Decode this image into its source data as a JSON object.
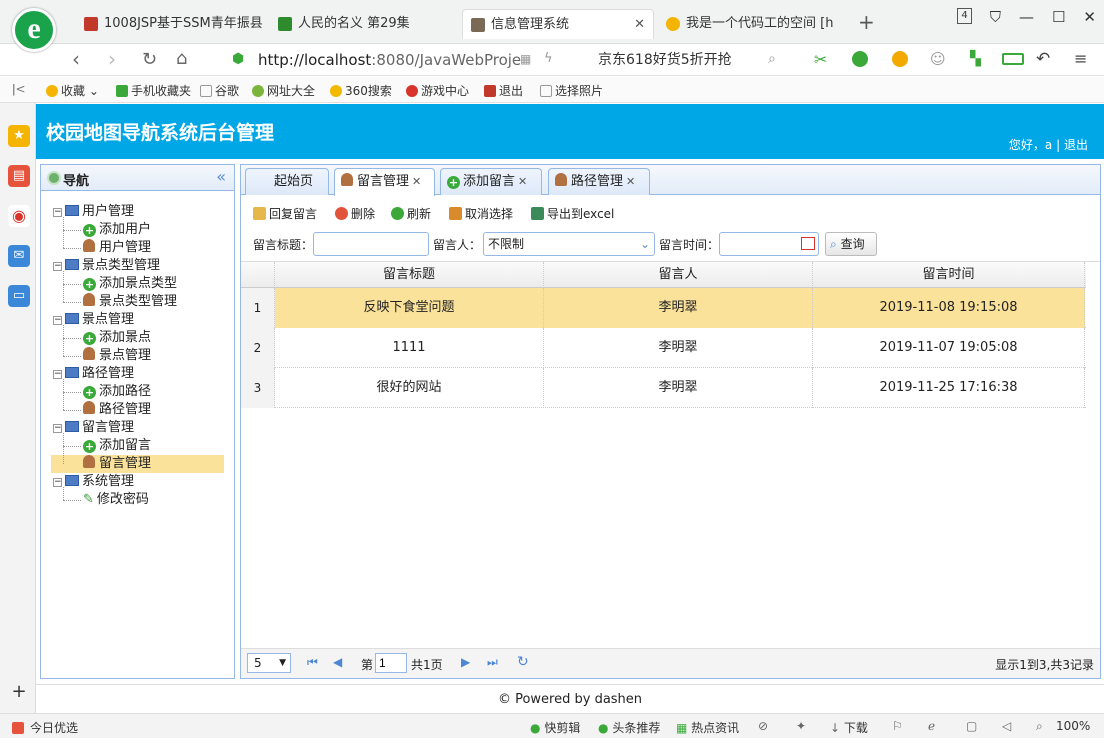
{
  "browser": {
    "tabs": [
      {
        "label": "1008JSP基于SSM青年振县",
        "favicon_color": "#c0392b"
      },
      {
        "label": "人民的名义 第29集",
        "favicon_color": "#2e8b2e"
      },
      {
        "label": "信息管理系统",
        "favicon_color": "#7a6a55",
        "close": "✕"
      },
      {
        "label": "我是一个代码工的空间 [h",
        "favicon_color": "#f5b400"
      }
    ],
    "new_tab": "+",
    "tab_count": "4",
    "url_host": "http://localhost",
    "url_rest": ":8080/JavaWebProje",
    "search_text": "京东618好货5折开抢",
    "fav_label": "收藏",
    "bookmarks": [
      "手机收藏夹",
      "谷歌",
      "网址大全",
      "360搜索",
      "游戏中心",
      "退出",
      "选择照片"
    ],
    "status_left": "今日优选",
    "status_items": [
      "快剪辑",
      "头条推荐",
      "热点资讯",
      "下载"
    ],
    "zoom": "100%"
  },
  "app": {
    "title": "校园地图导航系统后台管理",
    "greeting_prefix": "您好，a",
    "separator": "|",
    "logout": "退出",
    "nav": {
      "title": "导航",
      "collapse": "«",
      "groups": [
        {
          "label": "用户管理",
          "children": [
            {
              "label": "添加用户",
              "icon": "plus"
            },
            {
              "label": "用户管理",
              "icon": "user"
            }
          ]
        },
        {
          "label": "景点类型管理",
          "children": [
            {
              "label": "添加景点类型",
              "icon": "plus"
            },
            {
              "label": "景点类型管理",
              "icon": "user"
            }
          ]
        },
        {
          "label": "景点管理",
          "children": [
            {
              "label": "添加景点",
              "icon": "plus"
            },
            {
              "label": "景点管理",
              "icon": "user"
            }
          ]
        },
        {
          "label": "路径管理",
          "children": [
            {
              "label": "添加路径",
              "icon": "plus"
            },
            {
              "label": "路径管理",
              "icon": "user"
            }
          ]
        },
        {
          "label": "留言管理",
          "children": [
            {
              "label": "添加留言",
              "icon": "plus"
            },
            {
              "label": "留言管理",
              "icon": "user",
              "selected": true
            }
          ]
        },
        {
          "label": "系统管理",
          "children": [
            {
              "label": "修改密码",
              "icon": "pen"
            }
          ]
        }
      ]
    },
    "tabs": [
      {
        "label": "起始页"
      },
      {
        "label": "留言管理",
        "active": true
      },
      {
        "label": "添加留言"
      },
      {
        "label": "路径管理"
      }
    ],
    "toolbar": {
      "reply": "回复留言",
      "delete": "删除",
      "refresh": "刷新",
      "unselect": "取消选择",
      "export": "导出到excel"
    },
    "filters": {
      "title_label": "留言标题：",
      "title_value": "",
      "author_label": "留言人：",
      "author_value": "不限制",
      "time_label": "留言时间：",
      "time_value": "",
      "search": "查询"
    },
    "grid": {
      "columns": [
        "留言标题",
        "留言人",
        "留言时间"
      ],
      "rows": [
        {
          "n": "1",
          "title": "反映下食堂问题",
          "author": "李明翠",
          "time": "2019-11-08 19:15:08",
          "selected": true
        },
        {
          "n": "2",
          "title": "1111",
          "author": "李明翠",
          "time": "2019-11-07 19:05:08"
        },
        {
          "n": "3",
          "title": "很好的网站",
          "author": "李明翠",
          "time": "2019-11-25 17:16:38"
        }
      ]
    },
    "pager": {
      "page_size": "5",
      "page_prefix": "第",
      "page_value": "1",
      "page_total": "共1页",
      "summary": "显示1到3,共3记录"
    },
    "footer": "© Powered by dashen"
  }
}
